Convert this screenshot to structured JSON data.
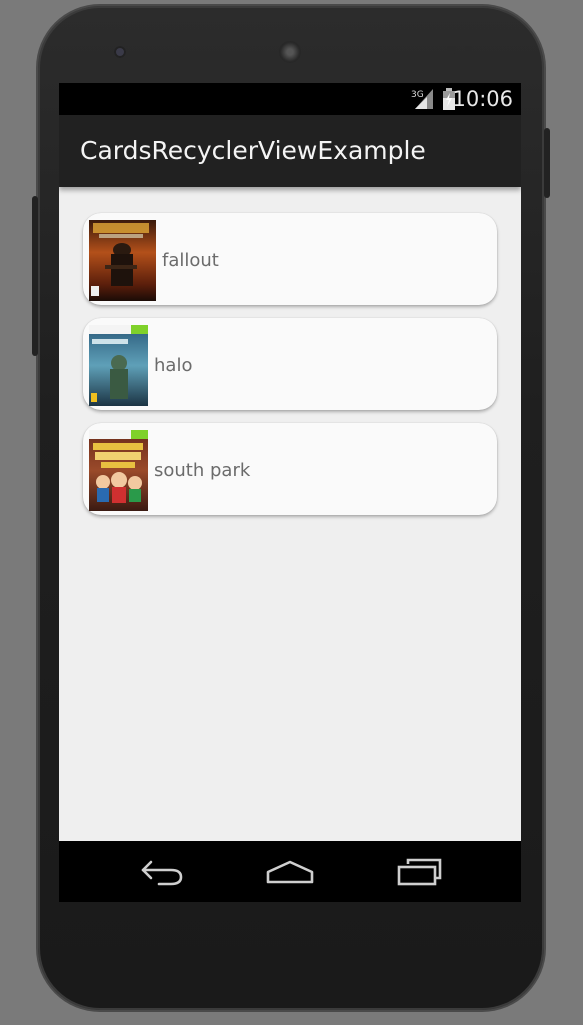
{
  "status_bar": {
    "network": "3G",
    "time": "10:06",
    "icons": [
      "signal-icon",
      "battery-icon"
    ]
  },
  "app": {
    "title": "CardsRecyclerViewExample"
  },
  "cards": [
    {
      "label": "fallout",
      "thumb_icon": "fallout-cover-image"
    },
    {
      "label": "halo",
      "thumb_icon": "halo-cover-image"
    },
    {
      "label": "south park",
      "thumb_icon": "south-park-cover-image"
    }
  ],
  "nav_bar": {
    "buttons": [
      "back-icon",
      "home-icon",
      "recents-icon"
    ]
  },
  "colors": {
    "action_bar": "#212121",
    "status_bar": "#000000",
    "background": "#efefef",
    "card": "#fafafa",
    "label_text": "#6b6b6b"
  }
}
